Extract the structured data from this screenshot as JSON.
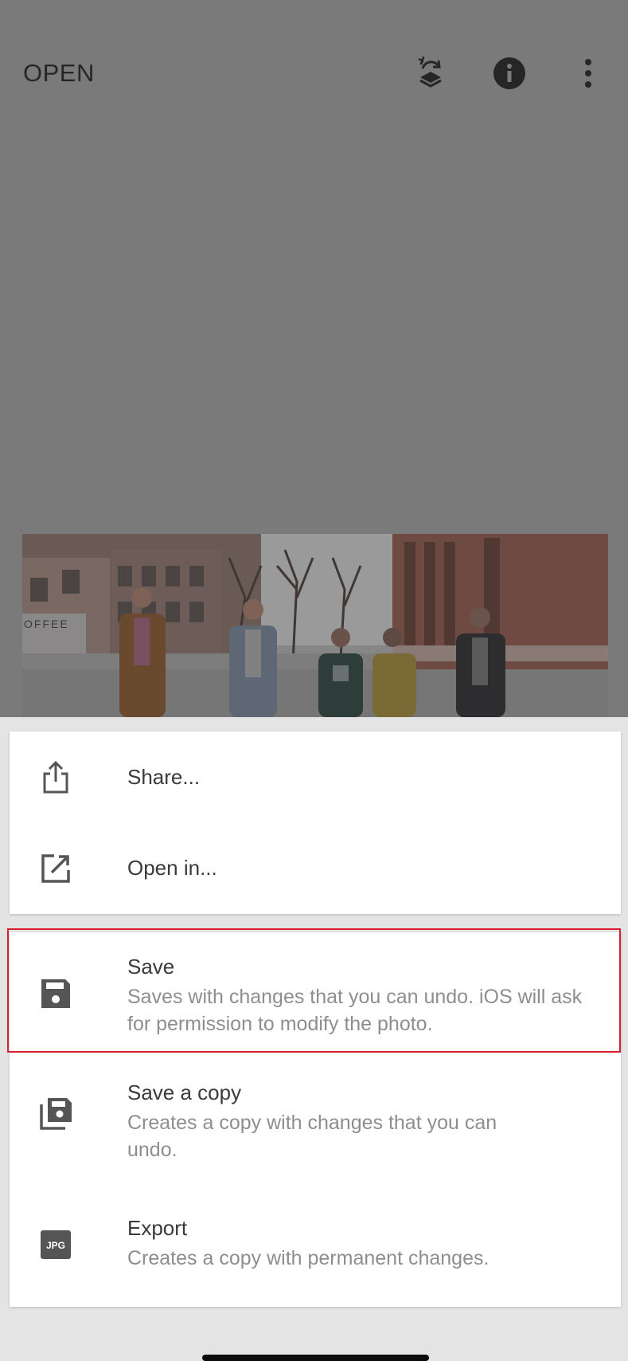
{
  "header": {
    "open_label": "OPEN",
    "icons": [
      "undo-layers-icon",
      "info-icon",
      "more-vertical-icon"
    ]
  },
  "menu": {
    "share_label": "Share...",
    "open_in_label": "Open in...",
    "save": {
      "title": "Save",
      "description": "Saves with changes that you can undo. iOS will ask for permission to modify the photo."
    },
    "save_copy": {
      "title": "Save a copy",
      "description": "Creates a copy with changes that you can undo."
    },
    "export": {
      "title": "Export",
      "description": "Creates a copy with permanent changes.",
      "badge": "JPG"
    }
  },
  "photo": {
    "sign_text": "OFFEE"
  },
  "colors": {
    "dim_overlay": "#7a7a7a",
    "sheet_background": "#e4e4e4",
    "highlight": "#d8202c"
  }
}
